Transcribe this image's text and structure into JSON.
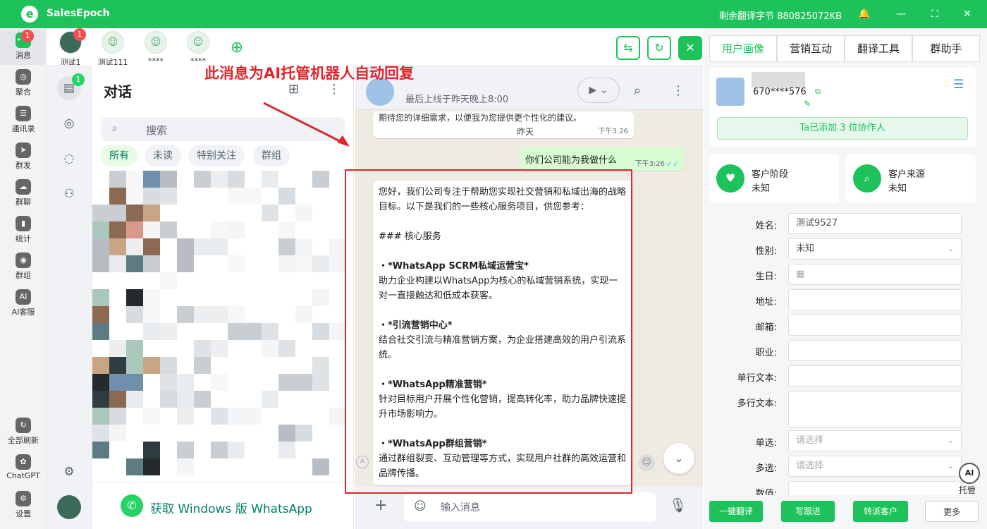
{
  "app": {
    "title": "SalesEpoch",
    "logo_letter": "e",
    "bytes_label": "剩余翻译字节 880825072KB"
  },
  "rail": {
    "items": [
      {
        "label": "消息",
        "icon": "message-icon",
        "badge": "1"
      },
      {
        "label": "聚合",
        "icon": "aggregate-icon"
      },
      {
        "label": "通讯录",
        "icon": "contacts-icon"
      },
      {
        "label": "群发",
        "icon": "broadcast-icon"
      },
      {
        "label": "群聊",
        "icon": "group-chat-icon"
      },
      {
        "label": "统计",
        "icon": "stats-icon"
      },
      {
        "label": "群组",
        "icon": "group-icon"
      },
      {
        "label": "AI客服",
        "icon": "ai-service-icon"
      }
    ],
    "bottom": [
      {
        "label": "全部刷新",
        "icon": "refresh-all-icon"
      },
      {
        "label": "ChatGPT",
        "icon": "chatgpt-icon"
      },
      {
        "label": "设置",
        "icon": "settings-icon"
      }
    ]
  },
  "accounts": [
    {
      "name": "测试1",
      "badge": "1"
    },
    {
      "name": "测试111"
    },
    {
      "name": "****"
    },
    {
      "name": "****"
    }
  ],
  "chatlist": {
    "title": "对话",
    "badge": "1",
    "search_placeholder": "搜索",
    "filters": [
      "所有",
      "未读",
      "特别关注",
      "群组"
    ],
    "get_windows": "获取 Windows 版 WhatsApp"
  },
  "annotation": "此消息为AI托管机器人自动回复",
  "conversation": {
    "status": "最后上线于昨天晚上8:00",
    "prev_text": "期待您的详细需求，以便我为您提供更个性化的建议。",
    "prev_time": "下午3:26",
    "date_sep": "昨天",
    "out_text": "你们公司能为我做什么",
    "out_time": "下午3:26",
    "reply": {
      "intro": "您好，我们公司专注于帮助您实现社交营销和私域出海的战略目标。以下是我们的一些核心服务项目，供您参考：",
      "heading": "### 核心服务",
      "items": [
        {
          "title": "・*WhatsApp SCRM私域运营宝*",
          "desc": "助力企业构建以WhatsApp为核心的私域营销系统，实现一对一直接触达和低成本获客。"
        },
        {
          "title": "・*引流营销中心*",
          "desc": "结合社交引流与精准营销方案，为企业搭建高效的用户引流系统。"
        },
        {
          "title": "・*WhatsApp精准营销*",
          "desc": "针对目标用户开展个性化营销，提高转化率，助力品牌快速提升市场影响力。"
        },
        {
          "title": "・*WhatsApp群组营销*",
          "desc": "通过群组裂变、互动管理等方式，实现用户社群的高效运营和品牌传播。"
        }
      ]
    },
    "composer_placeholder": "输入消息"
  },
  "right_panel": {
    "tabs": [
      "用户画像",
      "营销互动",
      "翻译工具",
      "群助手"
    ],
    "phone": "670****576",
    "collab": "Ta已添加 3 位协作人",
    "stage_label": "客户阶段",
    "stage_value": "未知",
    "source_label": "客户来源",
    "source_value": "未知",
    "fields": [
      {
        "label": "姓名:",
        "value": "测试9527"
      },
      {
        "label": "性别:",
        "value": "未知",
        "dropdown": true
      },
      {
        "label": "生日:",
        "value": ""
      },
      {
        "label": "地址:",
        "value": ""
      },
      {
        "label": "邮箱:",
        "value": ""
      },
      {
        "label": "职业:",
        "value": ""
      },
      {
        "label": "单行文本:",
        "value": ""
      },
      {
        "label": "多行文本:",
        "value": ""
      },
      {
        "label": "单选:",
        "placeholder": "请选择",
        "dropdown": true
      },
      {
        "label": "多选:",
        "placeholder": "请选择",
        "dropdown": true
      },
      {
        "label": "数值:",
        "value": ""
      }
    ],
    "actions": [
      "一键翻译",
      "写跟进",
      "转派客户",
      "更多"
    ],
    "ai_label": "托管"
  },
  "colors": {
    "brand": "#1ec25a",
    "annotation": "#e0262d"
  }
}
